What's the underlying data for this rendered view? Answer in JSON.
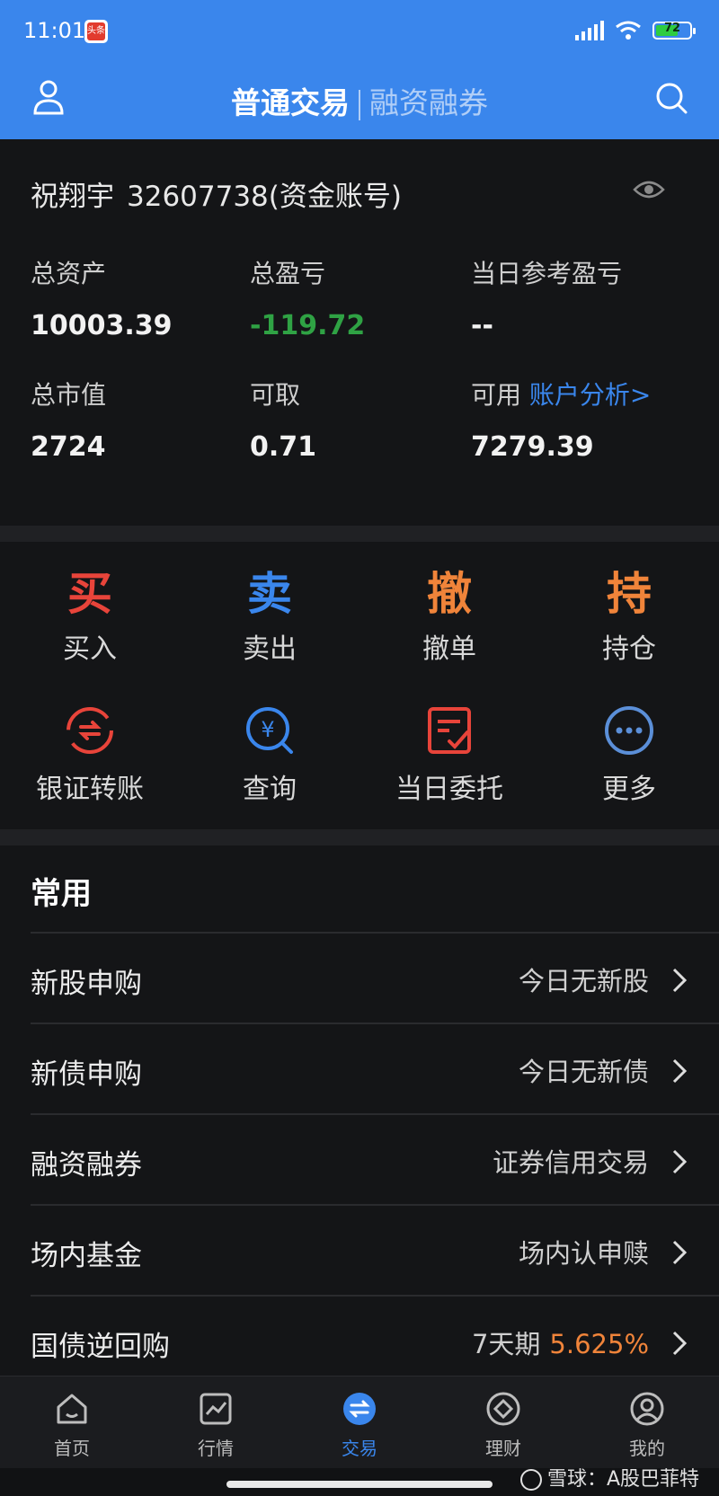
{
  "status": {
    "time": "11:01",
    "app_badge": "头条",
    "battery": "72"
  },
  "header": {
    "active_tab": "普通交易",
    "inactive_tab": "融资融券"
  },
  "account": {
    "name": "祝翔宇",
    "number": "32607738(资金账号)",
    "stats": [
      {
        "label": "总资产",
        "value": "10003.39"
      },
      {
        "label": "总盈亏",
        "value": "-119.72"
      },
      {
        "label": "当日参考盈亏",
        "value": "--"
      },
      {
        "label": "总市值",
        "value": "2724"
      },
      {
        "label": "可取",
        "value": "0.71"
      },
      {
        "label": "可用",
        "value": "7279.39",
        "link": "账户分析>"
      }
    ]
  },
  "actions": [
    {
      "glyph": "买",
      "label": "买入",
      "color": "#e8443a"
    },
    {
      "glyph": "卖",
      "label": "卖出",
      "color": "#3a86ec"
    },
    {
      "glyph": "撤",
      "label": "撤单",
      "color": "#f0843a"
    },
    {
      "glyph": "持",
      "label": "持仓",
      "color": "#f0843a"
    },
    {
      "icon": "transfer-icon",
      "label": "银证转账",
      "color": "#e8443a"
    },
    {
      "icon": "query-icon",
      "label": "查询",
      "color": "#3a86ec"
    },
    {
      "icon": "order-icon",
      "label": "当日委托",
      "color": "#e8443a"
    },
    {
      "icon": "more-icon",
      "label": "更多",
      "color": "#5b8fd8"
    }
  ],
  "common": {
    "title": "常用",
    "rows": [
      {
        "label": "新股申购",
        "value": "今日无新股"
      },
      {
        "label": "新债申购",
        "value": "今日无新债"
      },
      {
        "label": "融资融券",
        "value": "证券信用交易"
      },
      {
        "label": "场内基金",
        "value": "场内认申赎"
      },
      {
        "label": "国债逆回购",
        "value": "7天期",
        "rate": "5.625%"
      }
    ]
  },
  "tabbar": [
    {
      "label": "首页",
      "icon": "home-icon"
    },
    {
      "label": "行情",
      "icon": "chart-icon"
    },
    {
      "label": "交易",
      "icon": "trade-icon"
    },
    {
      "label": "理财",
      "icon": "wealth-icon"
    },
    {
      "label": "我的",
      "icon": "profile-icon"
    }
  ],
  "watermark": "雪球：A股巴菲特"
}
